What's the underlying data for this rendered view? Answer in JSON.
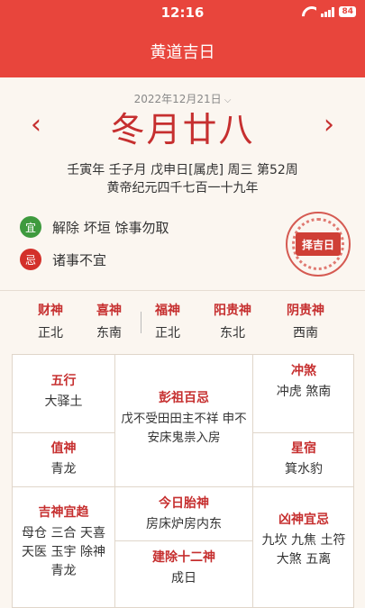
{
  "status": {
    "time": "12:16",
    "battery": "84"
  },
  "nav": {
    "title": "黄道吉日"
  },
  "date": {
    "solar": "2022年12月21日",
    "lunar": "冬月廿八",
    "ganzhi": "壬寅年 壬子月 戊申日[属虎] 周三 第52周",
    "era": "黄帝纪元四千七百一十九年",
    "prev": "‹",
    "next": "›"
  },
  "yiji": {
    "yi_label": "宜",
    "yi_text": "解除 坏垣 馀事勿取",
    "ji_label": "忌",
    "ji_text": "诸事不宜"
  },
  "seal": {
    "text": "择吉日"
  },
  "gods": [
    {
      "name": "财神",
      "dir": "正北"
    },
    {
      "name": "喜神",
      "dir": "东南"
    },
    {
      "name": "福神",
      "dir": "正北"
    },
    {
      "name": "阳贵神",
      "dir": "东北"
    },
    {
      "name": "阴贵神",
      "dir": "西南"
    }
  ],
  "grid": {
    "wuxing": {
      "title": "五行",
      "value": "大驿土"
    },
    "pengzu": {
      "title": "彭祖百忌",
      "value": "戊不受田田主不祥 申不安床鬼祟入房"
    },
    "chongsha": {
      "title": "冲煞",
      "value": "冲虎 煞南"
    },
    "zhishen": {
      "title": "值神",
      "value": "青龙"
    },
    "xingxiu": {
      "title": "星宿",
      "value": "箕水豹"
    },
    "jishen": {
      "title": "吉神宜趋",
      "value": "母仓 三合 天喜 天医 玉宇 除神 青龙"
    },
    "taishen": {
      "title": "今日胎神",
      "value": "房床炉房内东"
    },
    "jianchu": {
      "title": "建除十二神",
      "value": "成日"
    },
    "xiongshen": {
      "title": "凶神宜忌",
      "value": "九坎 九焦 土符 大煞 五离"
    }
  }
}
